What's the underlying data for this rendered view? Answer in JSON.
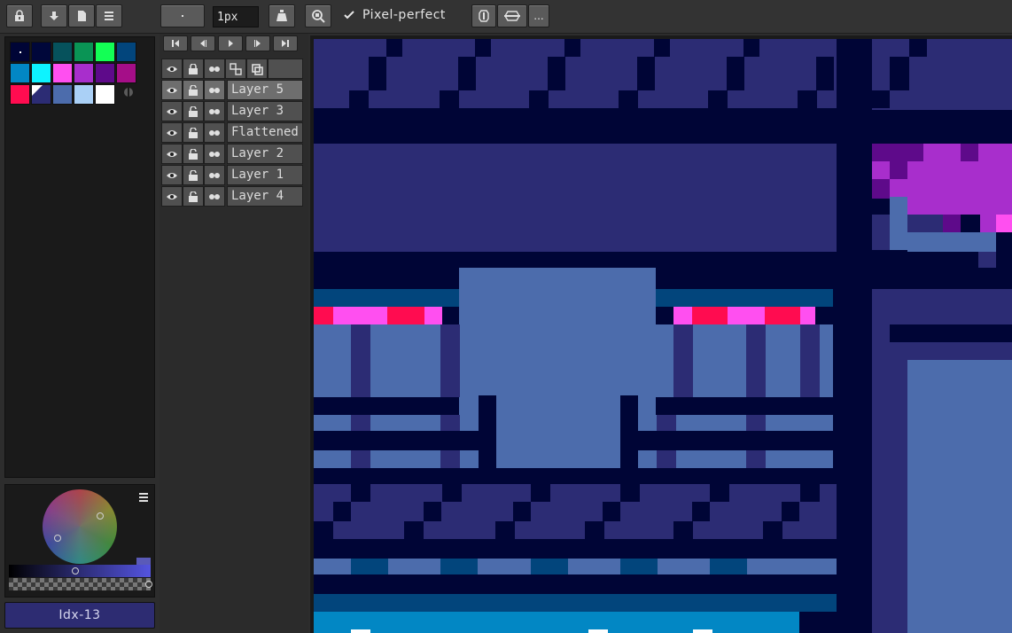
{
  "toolbar": {
    "brush_size": "1px",
    "pixel_perfect_label": "Pixel-perfect",
    "pixel_perfect_checked": true,
    "more_label": "..."
  },
  "palette": {
    "colors": [
      "#000536",
      "#00073a",
      "#06525c",
      "#0a9455",
      "#13ff55",
      "#02457c",
      "#0287c4",
      "#0df3ff",
      "#ff4ff0",
      "#a82ecc",
      "#5e0a8a",
      "#a50e88",
      "#ff0c50",
      "#2c2c74",
      "#4c6cac",
      "#aad0f6",
      "#ffffff"
    ]
  },
  "color_picker": {
    "index_label": "Idx-13"
  },
  "layers": [
    {
      "name": "Layer 5",
      "selected": true
    },
    {
      "name": "Layer 3",
      "selected": false
    },
    {
      "name": "Flattened",
      "selected": false
    },
    {
      "name": "Layer 2",
      "selected": false
    },
    {
      "name": "Layer 1",
      "selected": false
    },
    {
      "name": "Layer 4",
      "selected": false
    }
  ],
  "colors": {
    "app_bg": "#2d2d2d",
    "panel_bg": "#1a1a1a",
    "button_bg": "#5a5a5a",
    "canvas_dark": "#000536",
    "canvas_mid": "#2c2c74",
    "canvas_light": "#4c6cac",
    "canvas_pink": "#ff0c50",
    "canvas_magenta": "#ff4ff0",
    "canvas_purple": "#a82ecc",
    "canvas_cyan": "#0287c4"
  }
}
